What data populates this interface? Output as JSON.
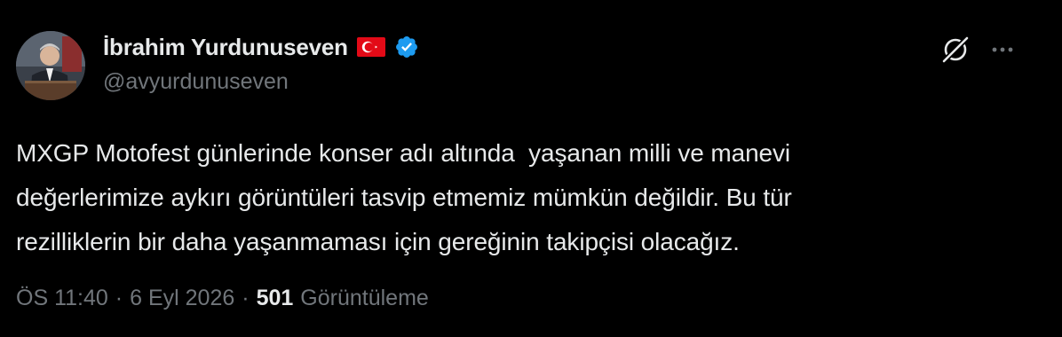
{
  "author": {
    "display_name": "İbrahim Yurdunuseven",
    "handle": "@avyurdunuseven",
    "flag_icon": "turkey-flag-emoji",
    "verified_icon": "verified-badge-icon",
    "verified_color": "#1d9bf0"
  },
  "actions": {
    "grok_icon": "grok-icon",
    "more_icon": "more-options-icon"
  },
  "tweet": {
    "text": "MXGP Motofest günlerinde konser adı altında  yaşanan milli ve manevi\ndeğerlerimize aykırı görüntüleri tasvip etmemiz mümkün değildir. Bu tür\nrezilliklerin bir daha yaşanmaması için gereğinin takipçisi olacağız."
  },
  "meta": {
    "time": "ÖS 11:40",
    "separator": "·",
    "date": "6 Eyl 2026",
    "views_count": "501",
    "views_label": "Görüntüleme"
  },
  "colors": {
    "background": "#000000",
    "primary_text": "#e7e9ea",
    "secondary_text": "#71767b"
  }
}
